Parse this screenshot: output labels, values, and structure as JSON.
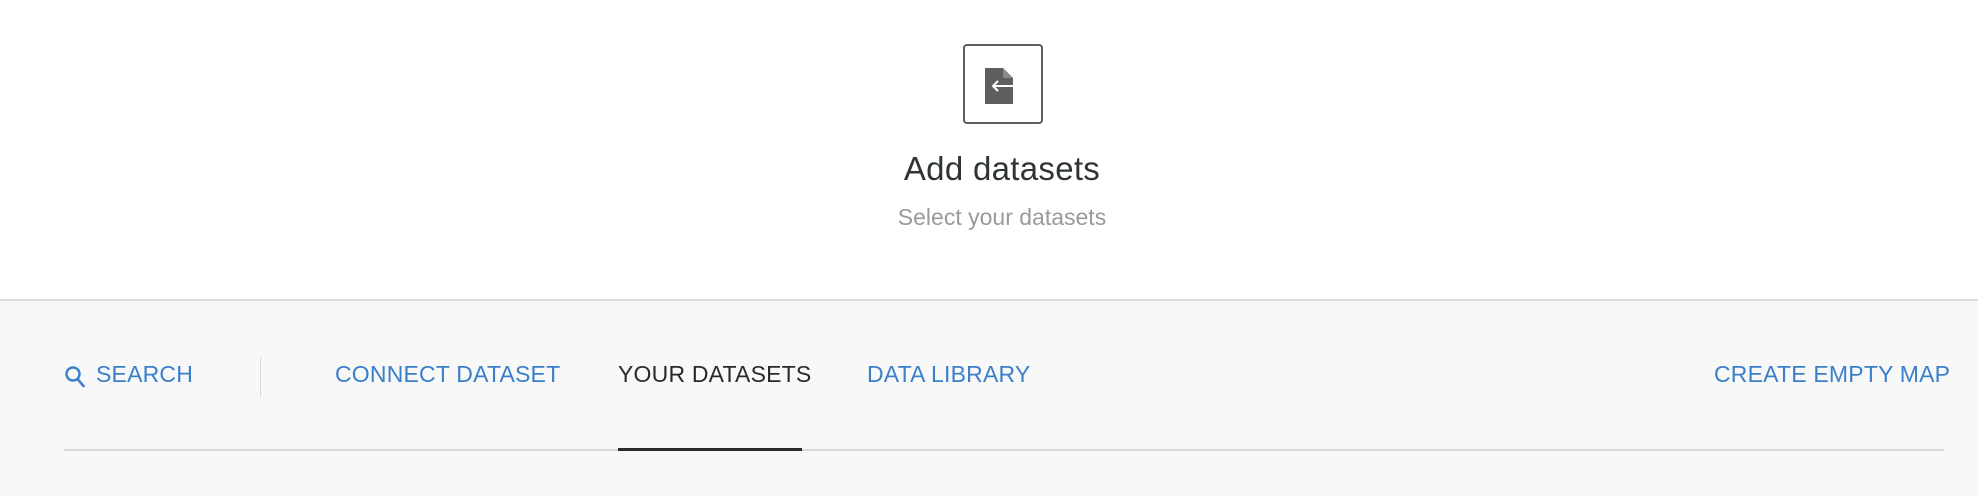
{
  "header": {
    "icon": "file-arrow-left-icon",
    "title": "Add datasets",
    "subtitle": "Select your datasets"
  },
  "tabs": {
    "search": {
      "label": "SEARCH",
      "icon": "search-icon"
    },
    "connect": {
      "label": "CONNECT DATASET"
    },
    "yours": {
      "label": "YOUR DATASETS",
      "active": true
    },
    "library": {
      "label": "DATA LIBRARY"
    },
    "create_empty": {
      "label": "CREATE EMPTY MAP"
    }
  },
  "colors": {
    "link": "#3a7fc9",
    "active_text": "#2a2a2a",
    "muted": "#9a9a9a",
    "tabbar_bg": "#f8f8f8"
  }
}
